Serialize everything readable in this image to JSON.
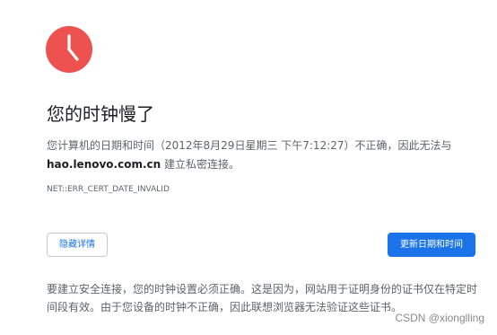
{
  "icon": "clock-icon",
  "colors": {
    "clock": "#ee5250",
    "primary": "#1a73e8",
    "text": "#202124",
    "secondary": "#5f6368"
  },
  "title": "您的时钟慢了",
  "description": {
    "line1": "您计算机的日期和时间（2012年8月29日星期三 下午7:12:27）不正确，因此无法与",
    "host": "hao.lenovo.com.cn",
    "line2_suffix": " 建立私密连接。"
  },
  "error_code": "NET::ERR_CERT_DATE_INVALID",
  "buttons": {
    "details": "隐藏详情",
    "update": "更新日期和时间"
  },
  "explanation": "要建立安全连接，您的时钟设置必须正确。这是因为，网站用于证明身份的证书仅在特定时间段有效。由于您设备的时钟不正确，因此联想浏览器无法验证这些证书。",
  "watermark": "CSDN @xionglling"
}
